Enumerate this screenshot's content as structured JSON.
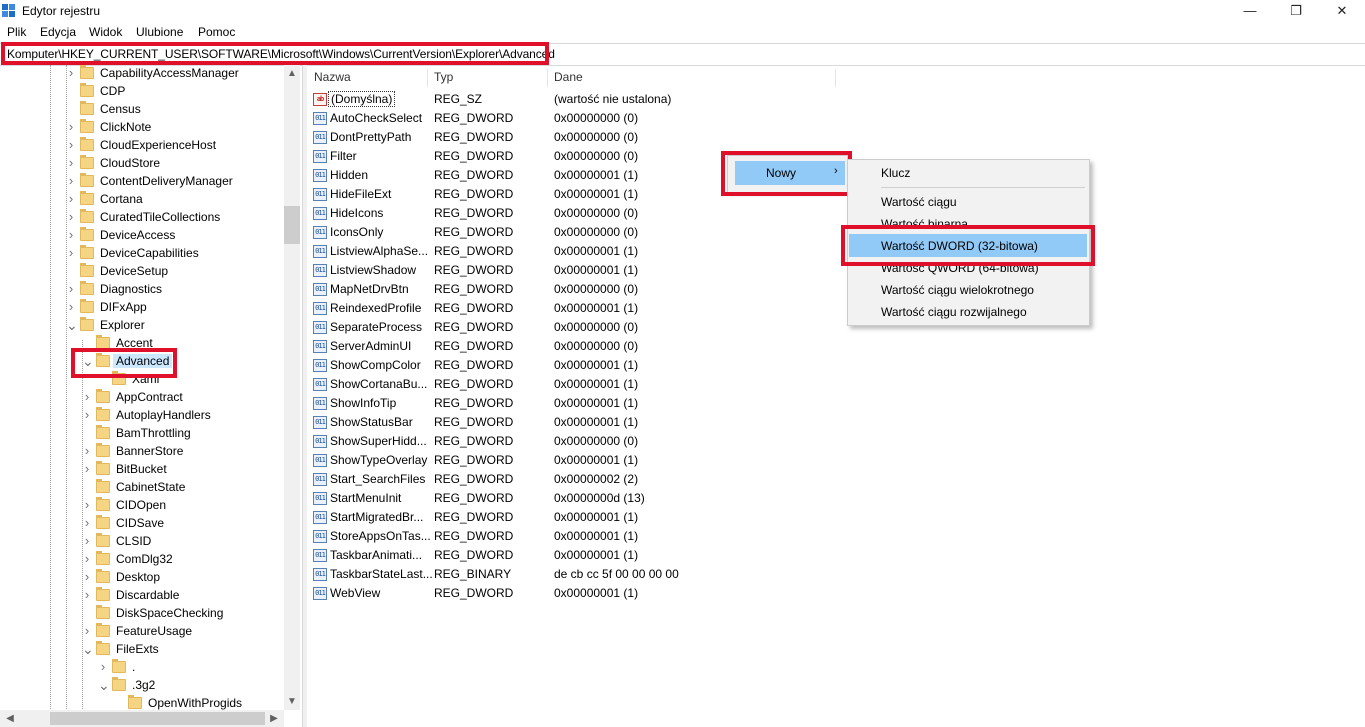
{
  "window": {
    "title": "Edytor rejestru",
    "controls": {
      "minimize": "—",
      "maximize": "❐",
      "close": "✕"
    }
  },
  "menu": [
    "Plik",
    "Edycja",
    "Widok",
    "Ulubione",
    "Pomoc"
  ],
  "address": "Komputer\\HKEY_CURRENT_USER\\SOFTWARE\\Microsoft\\Windows\\CurrentVersion\\Explorer\\Advanced",
  "tree": {
    "items": [
      {
        "label": "CapabilityAccessManager",
        "expanded": false
      },
      {
        "label": "CDP",
        "expanded": null
      },
      {
        "label": "Census",
        "expanded": null
      },
      {
        "label": "ClickNote",
        "expanded": false
      },
      {
        "label": "CloudExperienceHost",
        "expanded": false
      },
      {
        "label": "CloudStore",
        "expanded": false
      },
      {
        "label": "ContentDeliveryManager",
        "expanded": false
      },
      {
        "label": "Cortana",
        "expanded": false
      },
      {
        "label": "CuratedTileCollections",
        "expanded": false
      },
      {
        "label": "DeviceAccess",
        "expanded": false
      },
      {
        "label": "DeviceCapabilities",
        "expanded": false
      },
      {
        "label": "DeviceSetup",
        "expanded": null
      },
      {
        "label": "Diagnostics",
        "expanded": false
      },
      {
        "label": "DIFxApp",
        "expanded": false
      },
      {
        "label": "Explorer",
        "expanded": true
      },
      {
        "label": "Accent",
        "expanded": null
      },
      {
        "label": "Advanced",
        "expanded": true,
        "selected": true
      },
      {
        "label": "Xaml",
        "expanded": null
      },
      {
        "label": "AppContract",
        "expanded": false
      },
      {
        "label": "AutoplayHandlers",
        "expanded": false
      },
      {
        "label": "BamThrottling",
        "expanded": null
      },
      {
        "label": "BannerStore",
        "expanded": false
      },
      {
        "label": "BitBucket",
        "expanded": false
      },
      {
        "label": "CabinetState",
        "expanded": null
      },
      {
        "label": "CIDOpen",
        "expanded": false
      },
      {
        "label": "CIDSave",
        "expanded": false
      },
      {
        "label": "CLSID",
        "expanded": false
      },
      {
        "label": "ComDlg32",
        "expanded": false
      },
      {
        "label": "Desktop",
        "expanded": false
      },
      {
        "label": "Discardable",
        "expanded": false
      },
      {
        "label": "DiskSpaceChecking",
        "expanded": null
      },
      {
        "label": "FeatureUsage",
        "expanded": false
      },
      {
        "label": "FileExts",
        "expanded": true
      },
      {
        "label": ".",
        "expanded": false
      },
      {
        "label": ".3g2",
        "expanded": true
      },
      {
        "label": "OpenWithProgids",
        "expanded": null
      }
    ]
  },
  "list": {
    "columns": [
      "Nazwa",
      "Typ",
      "Dane"
    ],
    "rows": [
      {
        "name": "(Domyślna)",
        "type": "REG_SZ",
        "data": "(wartość nie ustalona)",
        "icon": "string-value-icon"
      },
      {
        "name": "AutoCheckSelect",
        "type": "REG_DWORD",
        "data": "0x00000000 (0)",
        "icon": "binary-value-icon"
      },
      {
        "name": "DontPrettyPath",
        "type": "REG_DWORD",
        "data": "0x00000000 (0)",
        "icon": "binary-value-icon"
      },
      {
        "name": "Filter",
        "type": "REG_DWORD",
        "data": "0x00000000 (0)",
        "icon": "binary-value-icon"
      },
      {
        "name": "Hidden",
        "type": "REG_DWORD",
        "data": "0x00000001 (1)",
        "icon": "binary-value-icon"
      },
      {
        "name": "HideFileExt",
        "type": "REG_DWORD",
        "data": "0x00000001 (1)",
        "icon": "binary-value-icon"
      },
      {
        "name": "HideIcons",
        "type": "REG_DWORD",
        "data": "0x00000000 (0)",
        "icon": "binary-value-icon"
      },
      {
        "name": "IconsOnly",
        "type": "REG_DWORD",
        "data": "0x00000000 (0)",
        "icon": "binary-value-icon"
      },
      {
        "name": "ListviewAlphaSe...",
        "type": "REG_DWORD",
        "data": "0x00000001 (1)",
        "icon": "binary-value-icon"
      },
      {
        "name": "ListviewShadow",
        "type": "REG_DWORD",
        "data": "0x00000001 (1)",
        "icon": "binary-value-icon"
      },
      {
        "name": "MapNetDrvBtn",
        "type": "REG_DWORD",
        "data": "0x00000000 (0)",
        "icon": "binary-value-icon"
      },
      {
        "name": "ReindexedProfile",
        "type": "REG_DWORD",
        "data": "0x00000001 (1)",
        "icon": "binary-value-icon"
      },
      {
        "name": "SeparateProcess",
        "type": "REG_DWORD",
        "data": "0x00000000 (0)",
        "icon": "binary-value-icon"
      },
      {
        "name": "ServerAdminUI",
        "type": "REG_DWORD",
        "data": "0x00000000 (0)",
        "icon": "binary-value-icon"
      },
      {
        "name": "ShowCompColor",
        "type": "REG_DWORD",
        "data": "0x00000001 (1)",
        "icon": "binary-value-icon"
      },
      {
        "name": "ShowCortanaBu...",
        "type": "REG_DWORD",
        "data": "0x00000001 (1)",
        "icon": "binary-value-icon"
      },
      {
        "name": "ShowInfoTip",
        "type": "REG_DWORD",
        "data": "0x00000001 (1)",
        "icon": "binary-value-icon"
      },
      {
        "name": "ShowStatusBar",
        "type": "REG_DWORD",
        "data": "0x00000001 (1)",
        "icon": "binary-value-icon"
      },
      {
        "name": "ShowSuperHidd...",
        "type": "REG_DWORD",
        "data": "0x00000000 (0)",
        "icon": "binary-value-icon"
      },
      {
        "name": "ShowTypeOverlay",
        "type": "REG_DWORD",
        "data": "0x00000001 (1)",
        "icon": "binary-value-icon"
      },
      {
        "name": "Start_SearchFiles",
        "type": "REG_DWORD",
        "data": "0x00000002 (2)",
        "icon": "binary-value-icon"
      },
      {
        "name": "StartMenuInit",
        "type": "REG_DWORD",
        "data": "0x0000000d (13)",
        "icon": "binary-value-icon"
      },
      {
        "name": "StartMigratedBr...",
        "type": "REG_DWORD",
        "data": "0x00000001 (1)",
        "icon": "binary-value-icon"
      },
      {
        "name": "StoreAppsOnTas...",
        "type": "REG_DWORD",
        "data": "0x00000001 (1)",
        "icon": "binary-value-icon"
      },
      {
        "name": "TaskbarAnimati...",
        "type": "REG_DWORD",
        "data": "0x00000001 (1)",
        "icon": "binary-value-icon"
      },
      {
        "name": "TaskbarStateLast...",
        "type": "REG_BINARY",
        "data": "de cb cc 5f 00 00 00 00",
        "icon": "binary-value-icon"
      },
      {
        "name": "WebView",
        "type": "REG_DWORD",
        "data": "0x00000001 (1)",
        "icon": "binary-value-icon"
      }
    ]
  },
  "context_menu": {
    "new_label": "Nowy",
    "arrow": "›",
    "submenu": [
      "Klucz",
      "Wartość ciągu",
      "Wartość binarna",
      "Wartość DWORD (32-bitowa)",
      "Wartość QWORD (64-bitowa)",
      "Wartość ciągu wielokrotnego",
      "Wartość ciągu rozwijalnego"
    ],
    "highlighted": "Wartość DWORD (32-bitowa)"
  },
  "colors": {
    "highlight_box": "#e0102a",
    "menu_hover": "#91c9f7",
    "tree_selected": "#cce8ff"
  }
}
